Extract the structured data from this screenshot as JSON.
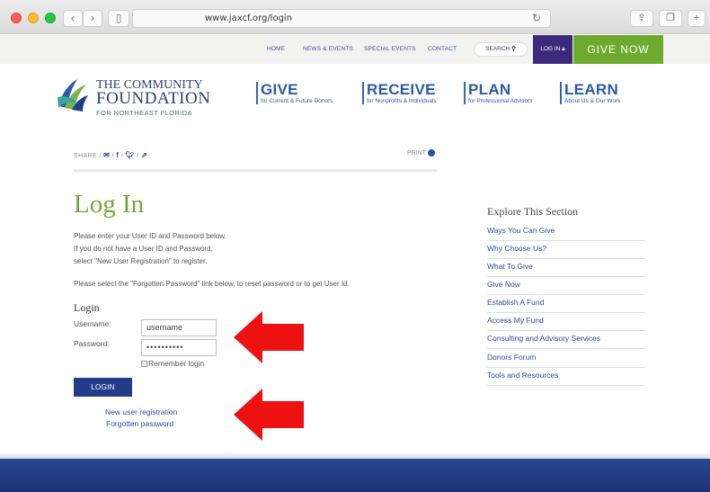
{
  "browser": {
    "url": "www.jaxcf.org/login"
  },
  "topnav": {
    "links": [
      "HOME",
      "NEWS & EVENTS",
      "SPECIAL EVENTS",
      "CONTACT"
    ],
    "search_label": "SEARCH",
    "login_label": "LOG IN",
    "give_now_label": "GIVE NOW"
  },
  "logo": {
    "line1": "THE COMMUNITY",
    "line2": "FOUNDATION",
    "line3": "FOR NORTHEAST FLORIDA"
  },
  "mainnav": [
    {
      "title": "GIVE",
      "sub": "for Current & Future Donors"
    },
    {
      "title": "RECEIVE",
      "sub": "for Nonprofits & Individuals"
    },
    {
      "title": "PLAN",
      "sub": "for Professional Advisors"
    },
    {
      "title": "LEARN",
      "sub": "About Us & Our Work"
    }
  ],
  "share": {
    "label": "SHARE",
    "print_label": "PRINT"
  },
  "main": {
    "title": "Log In",
    "intro1": "Please enter your User ID and Password below.",
    "intro2": "If you do not have a User ID and Password,",
    "intro3": "select \"New User Registration\" to register.",
    "intro4": "Please select the \"Forgotten Password\" link below, to reset password or to get User Id.",
    "login_heading": "Login",
    "username_label": "Username:",
    "username_value": "username",
    "password_label": "Password:",
    "password_value": "••••••••••",
    "remember_label": "Remember login",
    "submit_label": "LOGIN",
    "register_link": "New user registration",
    "forgot_link": "Forgotten password"
  },
  "sidebar": {
    "heading": "Explore This Section",
    "items": [
      "Ways You Can Give",
      "Why Choose Us?",
      "What To Give",
      "Give Now",
      "Establish A Fund",
      "Access My Fund",
      "Consulting and Advisory Services",
      "Donors Forum",
      "Tools and Resources"
    ]
  },
  "colors": {
    "accent_green": "#6eaa2e",
    "brand_blue": "#2b4ea0",
    "arrow_red": "#ee1111"
  }
}
